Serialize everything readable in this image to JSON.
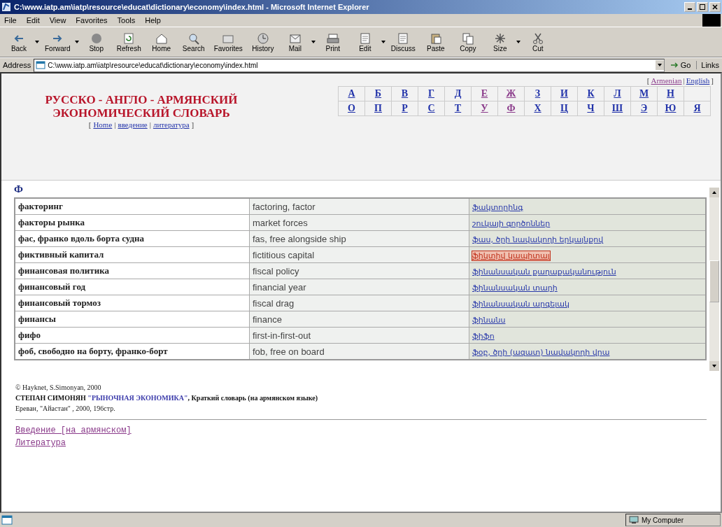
{
  "window": {
    "title": "C:\\www.iatp.am\\iatp\\resource\\educat\\dictionary\\economy\\index.html - Microsoft Internet Explorer"
  },
  "menu": [
    "File",
    "Edit",
    "View",
    "Favorites",
    "Tools",
    "Help"
  ],
  "toolbar": [
    {
      "label": "Back",
      "kind": "back",
      "dropdown": true
    },
    {
      "label": "Forward",
      "kind": "forward",
      "dropdown": true
    },
    {
      "label": "Stop",
      "kind": "stop",
      "dropdown": false
    },
    {
      "label": "Refresh",
      "kind": "refresh",
      "dropdown": false
    },
    {
      "label": "Home",
      "kind": "home",
      "dropdown": false
    },
    {
      "label": "Search",
      "kind": "search",
      "dropdown": false
    },
    {
      "label": "Favorites",
      "kind": "folder",
      "dropdown": false
    },
    {
      "label": "History",
      "kind": "clock",
      "dropdown": false
    },
    {
      "label": "Mail",
      "kind": "mail",
      "dropdown": true
    },
    {
      "label": "Print",
      "kind": "print",
      "dropdown": false
    },
    {
      "label": "Edit",
      "kind": "page",
      "dropdown": true
    },
    {
      "label": "Discuss",
      "kind": "page",
      "dropdown": false
    },
    {
      "label": "Paste",
      "kind": "paste",
      "dropdown": false
    },
    {
      "label": "Copy",
      "kind": "copy",
      "dropdown": false
    },
    {
      "label": "Size",
      "kind": "size",
      "dropdown": true
    },
    {
      "label": "Cut",
      "kind": "cut",
      "dropdown": false
    }
  ],
  "address": {
    "label": "Address",
    "value": "C:\\www.iatp.am\\iatp\\resource\\educat\\dictionary\\economy\\index.html",
    "go": "Go",
    "links": "Links"
  },
  "header": {
    "title_lines": [
      "РУССКО - АНГЛО - АРМЯНСКИЙ",
      "ЭКОНОМИЧЕСКИЙ СЛОВАРЬ"
    ],
    "nav_brackets": [
      "[",
      "|",
      "|",
      "]"
    ],
    "nav": [
      "Home",
      "введение",
      "литература"
    ],
    "lang_brackets": [
      "[",
      "|",
      "]"
    ],
    "languages": [
      {
        "label": "Armenian",
        "visited": true
      },
      {
        "label": "English",
        "visited": false
      }
    ]
  },
  "letters": [
    [
      {
        "label": "А",
        "visited": false
      },
      {
        "label": "Б",
        "visited": false
      },
      {
        "label": "В",
        "visited": false
      },
      {
        "label": "Г",
        "visited": false
      },
      {
        "label": "Д",
        "visited": false
      },
      {
        "label": "Е",
        "visited": true
      },
      {
        "label": "Ж",
        "visited": true
      },
      {
        "label": "З",
        "visited": false
      },
      {
        "label": "И",
        "visited": false
      },
      {
        "label": "К",
        "visited": false
      },
      {
        "label": "Л",
        "visited": false
      },
      {
        "label": "М",
        "visited": false
      },
      {
        "label": "Н",
        "visited": false
      }
    ],
    [
      {
        "label": "О",
        "visited": false
      },
      {
        "label": "П",
        "visited": false
      },
      {
        "label": "Р",
        "visited": false
      },
      {
        "label": "С",
        "visited": false
      },
      {
        "label": "Т",
        "visited": false
      },
      {
        "label": "У",
        "visited": true
      },
      {
        "label": "Ф",
        "visited": true
      },
      {
        "label": "Х",
        "visited": false
      },
      {
        "label": "Ц",
        "visited": false
      },
      {
        "label": "Ч",
        "visited": false
      },
      {
        "label": "Ш",
        "visited": false
      },
      {
        "label": "Э",
        "visited": false
      },
      {
        "label": "Ю",
        "visited": false
      },
      {
        "label": "Я",
        "visited": false
      }
    ]
  ],
  "section": {
    "letter": "Ф"
  },
  "table": {
    "rows": [
      {
        "russian": "факторинг",
        "english": "factoring, factor",
        "armenian": "ֆակտորինգ",
        "selected": false
      },
      {
        "russian": "факторы рынка",
        "english": "market forces",
        "armenian": "շուկայի գործոններ",
        "selected": false
      },
      {
        "russian": "фас, франко вдоль борта судна",
        "english": "fas, free alongside ship",
        "armenian": "ֆաս, ծրի նավակողի երկայնքով",
        "selected": false
      },
      {
        "russian": "фиктивный капитал",
        "english": "fictitious capital",
        "armenian": "ֆիկտիվ կապիտալ",
        "selected": true
      },
      {
        "russian": "финансовая политика",
        "english": "fiscal policy",
        "armenian": "ֆինանսական քաղաքականություն",
        "selected": false
      },
      {
        "russian": "финансовый год",
        "english": "financial year",
        "armenian": "ֆինանսական տարի",
        "selected": false
      },
      {
        "russian": "финансовый тормоз",
        "english": "fiscal drag",
        "armenian": "ֆինանսական արգելակ",
        "selected": false
      },
      {
        "russian": "финансы",
        "english": "finance",
        "armenian": "ֆինանս",
        "selected": false
      },
      {
        "russian": "фифо",
        "english": "first-in-first-out",
        "armenian": "ֆիֆո",
        "selected": false
      },
      {
        "russian": "фоб, свободно на борту, франко-борт",
        "english": "fob, free on board",
        "armenian": "ֆօբ, ծրի (ազատ) նավակողի վրա",
        "selected": false
      }
    ]
  },
  "footer": {
    "copyright": "© Hayknet, S.Simonyan, 2000",
    "citation": "СТЕПАН СИМОНЯН **\"РЫНОЧНАЯ ЭКОНОМИКА\"**, Краткий словарь (на армянском языке)",
    "imprint": "Ереван, \"Айастан\" , 2000, 196стр.",
    "links": [
      "Введение [на армянском]",
      "Литература"
    ]
  },
  "status_bar": {
    "zone": "My Computer"
  }
}
